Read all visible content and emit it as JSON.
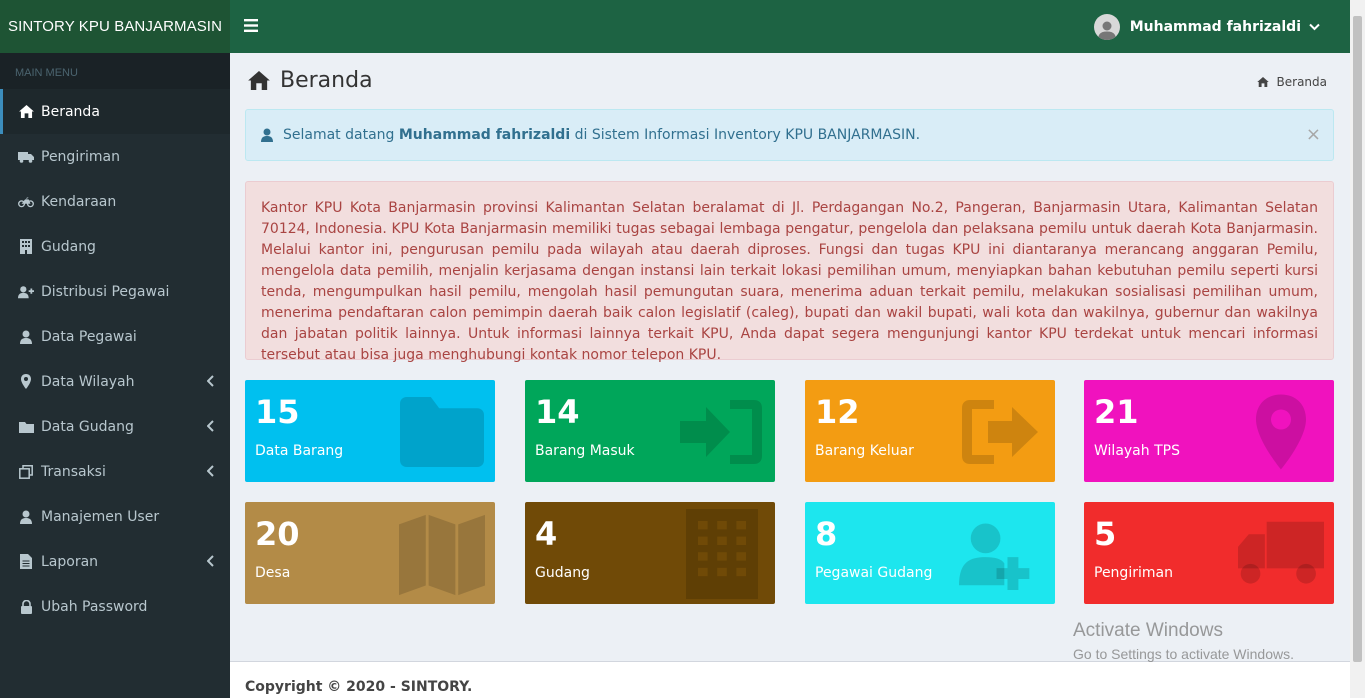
{
  "app": {
    "brand": "SINTORY KPU BANJARMASIN"
  },
  "header": {
    "user_name": "Muhammad fahrizaldi"
  },
  "sidebar": {
    "header": "MAIN MENU",
    "items": [
      {
        "label": "Beranda",
        "icon": "home-icon"
      },
      {
        "label": "Pengiriman",
        "icon": "truck-icon"
      },
      {
        "label": "Kendaraan",
        "icon": "motorcycle-icon"
      },
      {
        "label": "Gudang",
        "icon": "building-icon"
      },
      {
        "label": "Distribusi Pegawai",
        "icon": "user-plus-icon"
      },
      {
        "label": "Data Pegawai",
        "icon": "user-icon"
      },
      {
        "label": "Data Wilayah",
        "icon": "map-marker-icon"
      },
      {
        "label": "Data Gudang",
        "icon": "folder-icon"
      },
      {
        "label": "Transaksi",
        "icon": "clone-icon"
      },
      {
        "label": "Manajemen User",
        "icon": "user-icon"
      },
      {
        "label": "Laporan",
        "icon": "file-icon"
      },
      {
        "label": "Ubah Password",
        "icon": "lock-icon"
      }
    ]
  },
  "page": {
    "title": "Beranda",
    "breadcrumb": "Beranda"
  },
  "welcome": {
    "prefix": "Selamat datang",
    "name": "Muhammad fahrizaldi",
    "suffix": "di Sistem Informasi Inventory KPU BANJARMASIN.",
    "close": "×"
  },
  "info_text": "Kantor KPU Kota Banjarmasin provinsi Kalimantan Selatan beralamat di Jl. Perdagangan No.2, Pangeran, Banjarmasin Utara, Kalimantan Selatan 70124, Indonesia. KPU Kota Banjarmasin memiliki tugas sebagai lembaga pengatur, pengelola dan pelaksana pemilu untuk daerah Kota Banjarmasin. Melalui kantor ini, pengurusan pemilu pada wilayah atau daerah diproses. Fungsi dan tugas KPU ini diantaranya merancang anggaran Pemilu, mengelola data pemilih, menjalin kerjasama dengan instansi lain terkait lokasi pemilihan umum, menyiapkan bahan kebutuhan pemilu seperti kursi tenda, mengumpulkan hasil pemilu, mengolah hasil pemungutan suara, menerima aduan terkait pemilu, melakukan sosialisasi pemilihan umum, menerima pendaftaran calon pemimpin daerah baik calon legislatif (caleg), bupati dan wakil bupati, wali kota dan wakilnya, gubernur dan wakilnya dan jabatan politik lainnya. Untuk informasi lainnya terkait KPU, Anda dapat segera mengunjungi kantor KPU terdekat untuk mencari informasi tersebut atau bisa juga menghubungi kontak nomor telepon KPU.",
  "boxes": [
    {
      "count": "15",
      "label": "Data Barang",
      "color": "#00c0ef",
      "icon": "folder-icon"
    },
    {
      "count": "14",
      "label": "Barang Masuk",
      "color": "#00a65a",
      "icon": "sign-in-icon"
    },
    {
      "count": "12",
      "label": "Barang Keluar",
      "color": "#f39c12",
      "icon": "sign-out-icon"
    },
    {
      "count": "21",
      "label": "Wilayah TPS",
      "color": "#f012be",
      "icon": "map-marker-icon"
    },
    {
      "count": "20",
      "label": "Desa",
      "color": "#b38b47",
      "icon": "map-icon"
    },
    {
      "count": "4",
      "label": "Gudang",
      "color": "#704a07",
      "icon": "building-icon"
    },
    {
      "count": "8",
      "label": "Pegawai Gudang",
      "color": "#1de6ee",
      "icon": "user-plus-icon"
    },
    {
      "count": "5",
      "label": "Pengiriman",
      "color": "#f12c2c",
      "icon": "truck-icon"
    }
  ],
  "footer": {
    "text": "Copyright © 2020 - SINTORY."
  },
  "watermark": {
    "line1": "Activate Windows",
    "line2": "Go to Settings to activate Windows."
  }
}
